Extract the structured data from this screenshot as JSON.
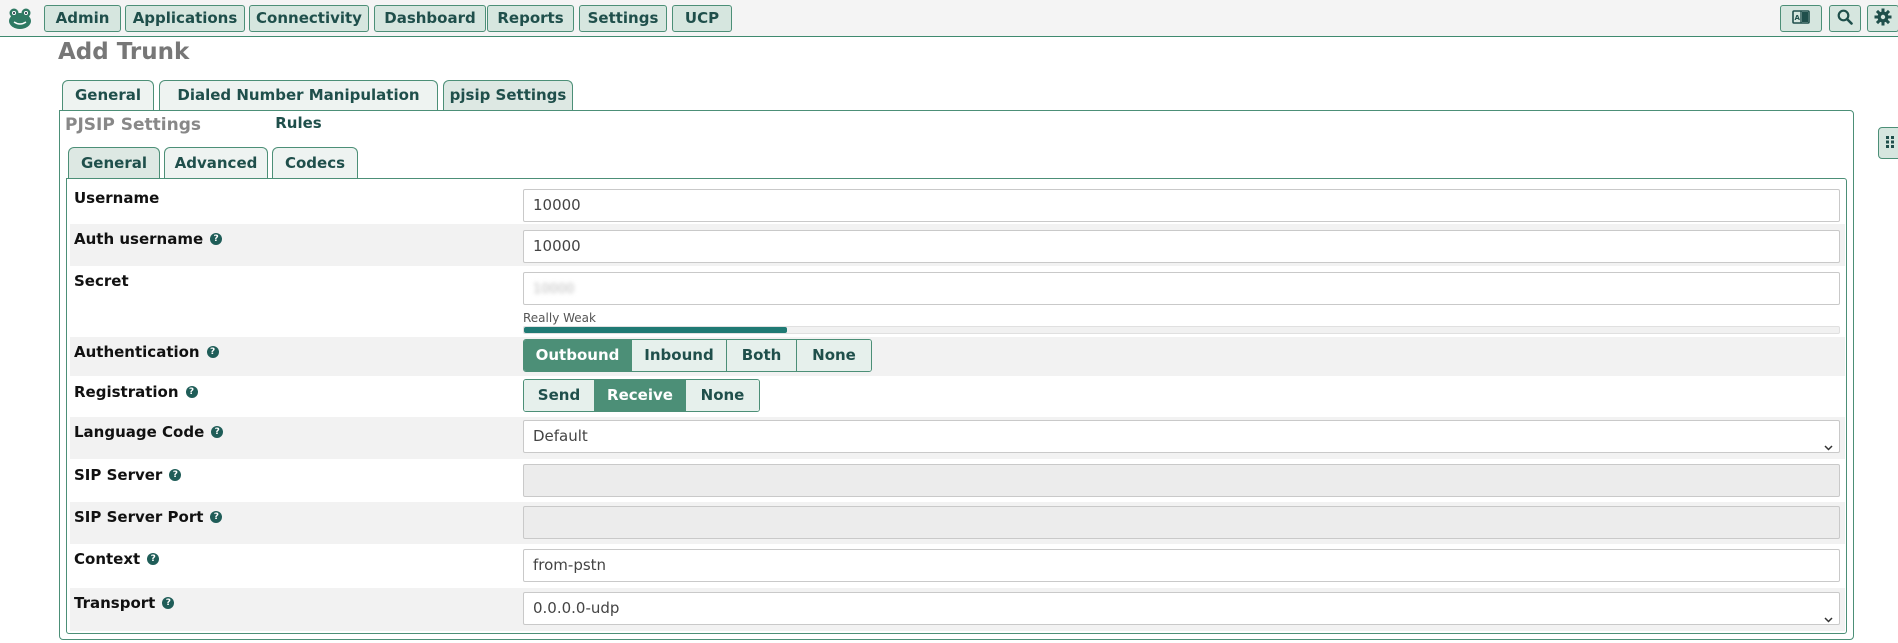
{
  "nav": {
    "items": [
      "Admin",
      "Applications",
      "Connectivity",
      "Dashboard",
      "Reports",
      "Settings",
      "UCP"
    ],
    "tools": [
      "language-icon",
      "search-icon",
      "gear-icon"
    ]
  },
  "page": {
    "title": "Add Trunk"
  },
  "outer_tabs": [
    {
      "label": "General"
    },
    {
      "label": "Dialed Number Manipulation Rules"
    },
    {
      "label": "pjsip Settings",
      "active": true
    }
  ],
  "panel": {
    "title": "PJSIP Settings"
  },
  "inner_tabs": [
    {
      "label": "General",
      "active": true
    },
    {
      "label": "Advanced"
    },
    {
      "label": "Codecs"
    }
  ],
  "form": {
    "username": {
      "label": "Username",
      "value": "10000"
    },
    "auth_username": {
      "label": "Auth username",
      "value": "10000"
    },
    "secret": {
      "label": "Secret",
      "value": "10000",
      "strength_label": "Really Weak",
      "strength_fraction": 0.2
    },
    "authentication": {
      "label": "Authentication",
      "options": [
        "Outbound",
        "Inbound",
        "Both",
        "None"
      ],
      "selected": "Outbound"
    },
    "registration": {
      "label": "Registration",
      "options": [
        "Send",
        "Receive",
        "None"
      ],
      "selected": "Receive"
    },
    "language_code": {
      "label": "Language Code",
      "value": "Default"
    },
    "sip_server": {
      "label": "SIP Server",
      "value": ""
    },
    "sip_server_port": {
      "label": "SIP Server Port",
      "value": ""
    },
    "context": {
      "label": "Context",
      "value": "from-pstn"
    },
    "transport": {
      "label": "Transport",
      "value": "0.0.0.0-udp"
    }
  },
  "colors": {
    "accent": "#4c8f77",
    "accent_dark": "#1f4f4b",
    "strength": "#1f7a74"
  }
}
